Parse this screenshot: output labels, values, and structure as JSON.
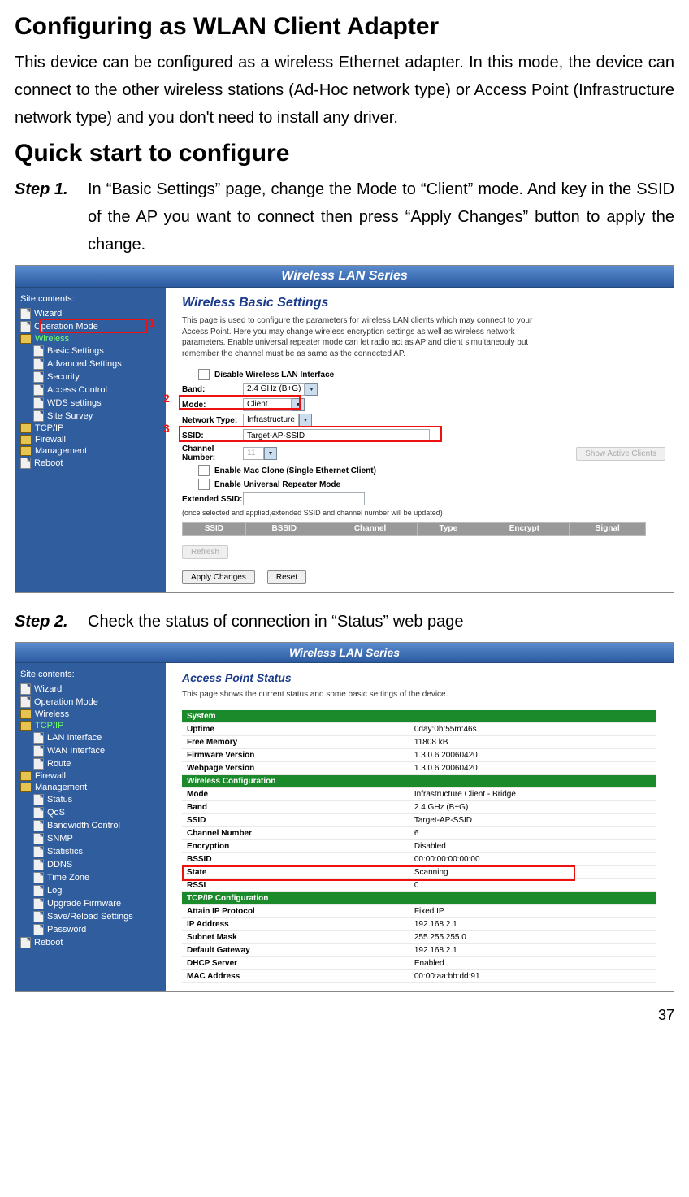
{
  "heading1": "Configuring as WLAN Client Adapter",
  "intro": "This device can be configured as a wireless Ethernet adapter. In this mode, the device can connect to the other wireless stations (Ad-Hoc network type) or Access Point (Infrastructure network type) and you don't need to install any driver.",
  "heading2": "Quick start to configure",
  "step1_label": "Step 1.",
  "step1_text": "In “Basic Settings” page, change the Mode to “Client” mode. And key in the SSID of the AP you want to connect then press “Apply Changes” button to apply the change.",
  "step2_label": "Step 2.",
  "step2_text": "Check the status of connection in “Status” web page",
  "page_number": "37",
  "marker1": "1",
  "marker2": "2",
  "marker3": "3",
  "shot1": {
    "titlebar": "Wireless LAN Series",
    "side_header": "Site contents:",
    "tree_top": [
      "Wizard",
      "Operation Mode"
    ],
    "tree_active": "Wireless",
    "tree_sub": [
      "Basic Settings",
      "Advanced Settings",
      "Security",
      "Access Control",
      "WDS settings",
      "Site Survey"
    ],
    "tree_after": [
      "TCP/IP",
      "Firewall",
      "Management",
      "Reboot"
    ],
    "title": "Wireless Basic Settings",
    "desc": "This page is used to configure the parameters for wireless LAN clients which may connect to your Access Point. Here you may change wireless encryption settings as well as wireless network parameters. Enable universal repeater mode can let radio act as AP and client simultaneouly but remember the channel must be as same as the connected AP.",
    "disable_label": "Disable Wireless LAN Interface",
    "band_label": "Band:",
    "band_value": "2.4 GHz (B+G)",
    "mode_label": "Mode:",
    "mode_value": "Client",
    "nettype_label": "Network Type:",
    "nettype_value": "Infrastructure",
    "ssid_label": "SSID:",
    "ssid_value": "Target-AP-SSID",
    "chan_label": "Channel Number:",
    "chan_value": "11",
    "show_clients": "Show Active Clients",
    "macclone": "Enable Mac Clone (Single Ethernet Client)",
    "univrep": "Enable Universal Repeater Mode",
    "ext_ssid_label": "Extended SSID:",
    "ext_note": "(once selected and applied,extended SSID and channel number will be updated)",
    "cols": [
      "SSID",
      "BSSID",
      "Channel",
      "Type",
      "Encrypt",
      "Signal"
    ],
    "refresh": "Refresh",
    "apply": "Apply Changes",
    "reset": "Reset"
  },
  "shot2": {
    "titlebar": "Wireless LAN Series",
    "side_header": "Site contents:",
    "tree_top": [
      "Wizard",
      "Operation Mode",
      "Wireless"
    ],
    "tree_active": "TCP/IP",
    "tree_sub": [
      "LAN Interface",
      "WAN Interface",
      "Route"
    ],
    "tree_fw": "Firewall",
    "tree_mgmt": "Management",
    "tree_mgmt_sub": [
      "Status",
      "QoS",
      "Bandwidth Control",
      "SNMP",
      "Statistics",
      "DDNS",
      "Time Zone",
      "Log",
      "Upgrade Firmware",
      "Save/Reload Settings",
      "Password"
    ],
    "tree_reboot": "Reboot",
    "title": "Access Point Status",
    "desc": "This page shows the current status and some basic settings of the device.",
    "sec1": "System",
    "rows1": [
      [
        "Uptime",
        "0day:0h:55m:46s"
      ],
      [
        "Free Memory",
        "11808 kB"
      ],
      [
        "Firmware Version",
        "1.3.0.6.20060420"
      ],
      [
        "Webpage Version",
        "1.3.0.6.20060420"
      ]
    ],
    "sec2": "Wireless Configuration",
    "rows2": [
      [
        "Mode",
        "Infrastructure Client - Bridge"
      ],
      [
        "Band",
        "2.4 GHz (B+G)"
      ],
      [
        "SSID",
        "Target-AP-SSID"
      ],
      [
        "Channel Number",
        "6"
      ],
      [
        "Encryption",
        "Disabled"
      ],
      [
        "BSSID",
        "00:00:00:00:00:00"
      ],
      [
        "State",
        "Scanning"
      ],
      [
        "RSSI",
        "0"
      ]
    ],
    "sec3": "TCP/IP Configuration",
    "rows3": [
      [
        "Attain IP Protocol",
        "Fixed IP"
      ],
      [
        "IP Address",
        "192.168.2.1"
      ],
      [
        "Subnet Mask",
        "255.255.255.0"
      ],
      [
        "Default Gateway",
        "192.168.2.1"
      ],
      [
        "DHCP Server",
        "Enabled"
      ],
      [
        "MAC Address",
        "00:00:aa:bb:dd:91"
      ]
    ]
  }
}
